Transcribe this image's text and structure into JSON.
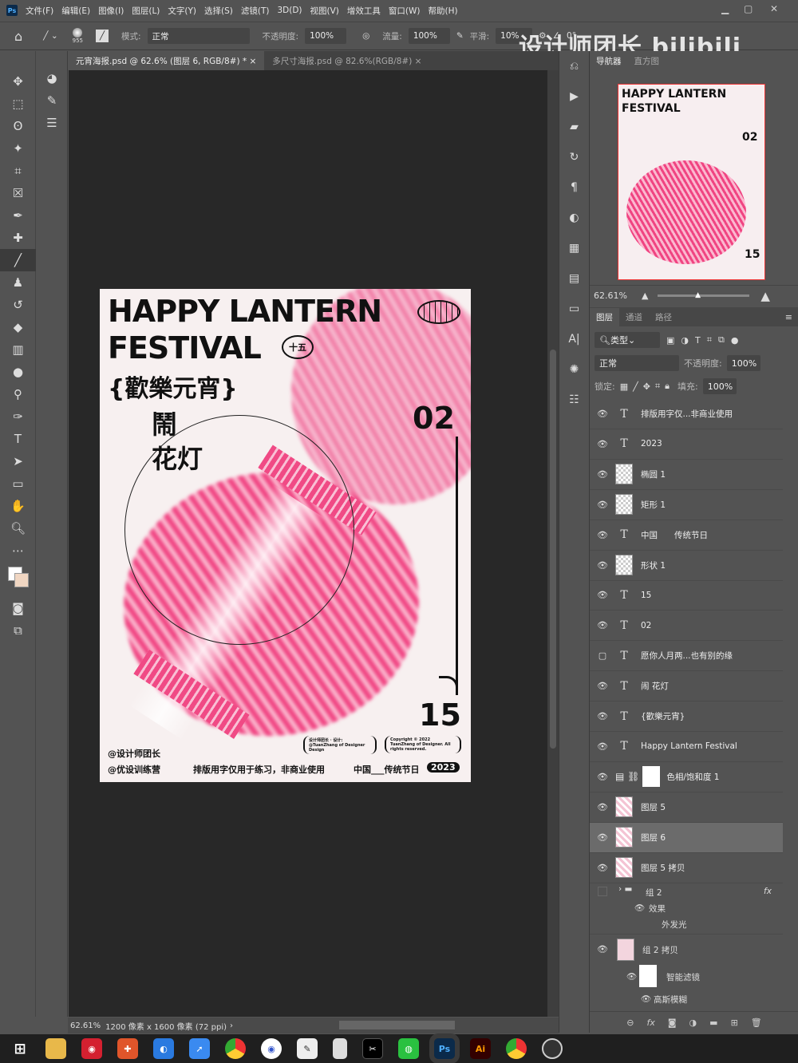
{
  "menu": [
    "文件(F)",
    "编辑(E)",
    "图像(I)",
    "图层(L)",
    "文字(Y)",
    "选择(S)",
    "滤镜(T)",
    "3D(D)",
    "视图(V)",
    "增效工具",
    "窗口(W)",
    "帮助(H)"
  ],
  "options": {
    "brush_size": "955",
    "mode_label": "模式:",
    "mode": "正常",
    "opacity_label": "不透明度:",
    "opacity": "100%",
    "flow_label": "流量:",
    "flow": "100%",
    "smooth_label": "平滑:",
    "smooth": "10%",
    "angle": "0°"
  },
  "tabs": [
    {
      "label": "元宵海报.psd @ 62.6% (图层 6, RGB/8#) *",
      "close": "×"
    },
    {
      "label": "多尺寸海报.psd @ 82.6%(RGB/8#)",
      "close": "×"
    }
  ],
  "watermark": "设计师团长 bilibili",
  "poster": {
    "title1": "HAPPY LANTERN",
    "title2": "FESTIVAL",
    "badge": "十五",
    "cn1": "{歡樂元宵}",
    "cn2": "鬧",
    "cn3": "花灯",
    "num1": "02",
    "num2": "15",
    "handle1": "@设计师团长",
    "handle2": "@优设训练营",
    "credit1": "设计师团长 · 设计: @TuanZhang of Designer Design",
    "credit2": "Copyright © 2022 TuanZhang of Designer. All rights reserved.",
    "note": "排版用字仅用于练习，非商业使用",
    "festival": "中国___传统节日",
    "year": "2023"
  },
  "status": {
    "zoom": "62.61%",
    "info": "1200 像素 x 1600 像素 (72 ppi)"
  },
  "navigator": {
    "tabs": [
      "导航器",
      "直方图"
    ],
    "zoom": "62.61%",
    "zoom_fraction": 0.45
  },
  "layers_panel": {
    "tabs": [
      "图层",
      "通道",
      "路径"
    ],
    "filter": "类型",
    "blend": "正常",
    "opacity_label": "不透明度:",
    "opacity": "100%",
    "lock_label": "锁定:",
    "fill_label": "填充:",
    "fill": "100%",
    "layers": [
      {
        "type": "text",
        "name": "排版用字仅...非商业使用",
        "visible": true
      },
      {
        "type": "text",
        "name": "2023",
        "visible": true
      },
      {
        "type": "shape",
        "name": "椭圆 1",
        "visible": true
      },
      {
        "type": "shape",
        "name": "矩形 1",
        "visible": true
      },
      {
        "type": "text",
        "name": "中国　　传统节日",
        "visible": true
      },
      {
        "type": "shape",
        "name": "形状 1",
        "visible": true
      },
      {
        "type": "text",
        "name": "15",
        "visible": true
      },
      {
        "type": "text",
        "name": "02",
        "visible": true
      },
      {
        "type": "text",
        "name": "愿你人月两...也有别的缘",
        "visible": false
      },
      {
        "type": "text",
        "name": "闹 花灯",
        "visible": true
      },
      {
        "type": "text",
        "name": "{歡樂元宵}",
        "visible": true
      },
      {
        "type": "text",
        "name": "Happy Lantern Festival",
        "visible": true
      },
      {
        "type": "adjust",
        "name": "色相/饱和度 1",
        "visible": true
      },
      {
        "type": "pixel",
        "name": "图层 5",
        "visible": true
      },
      {
        "type": "pixel",
        "name": "图层 6",
        "visible": true,
        "selected": true
      },
      {
        "type": "pixel",
        "name": "图层 5 拷贝",
        "visible": true
      }
    ],
    "group": {
      "name": "组 2",
      "fx": "fx",
      "effects": "效果",
      "effect": "外发光"
    },
    "group_copy": {
      "name": "组 2 拷贝",
      "smart": "智能滤镜",
      "filter": "高斯模糊"
    }
  }
}
